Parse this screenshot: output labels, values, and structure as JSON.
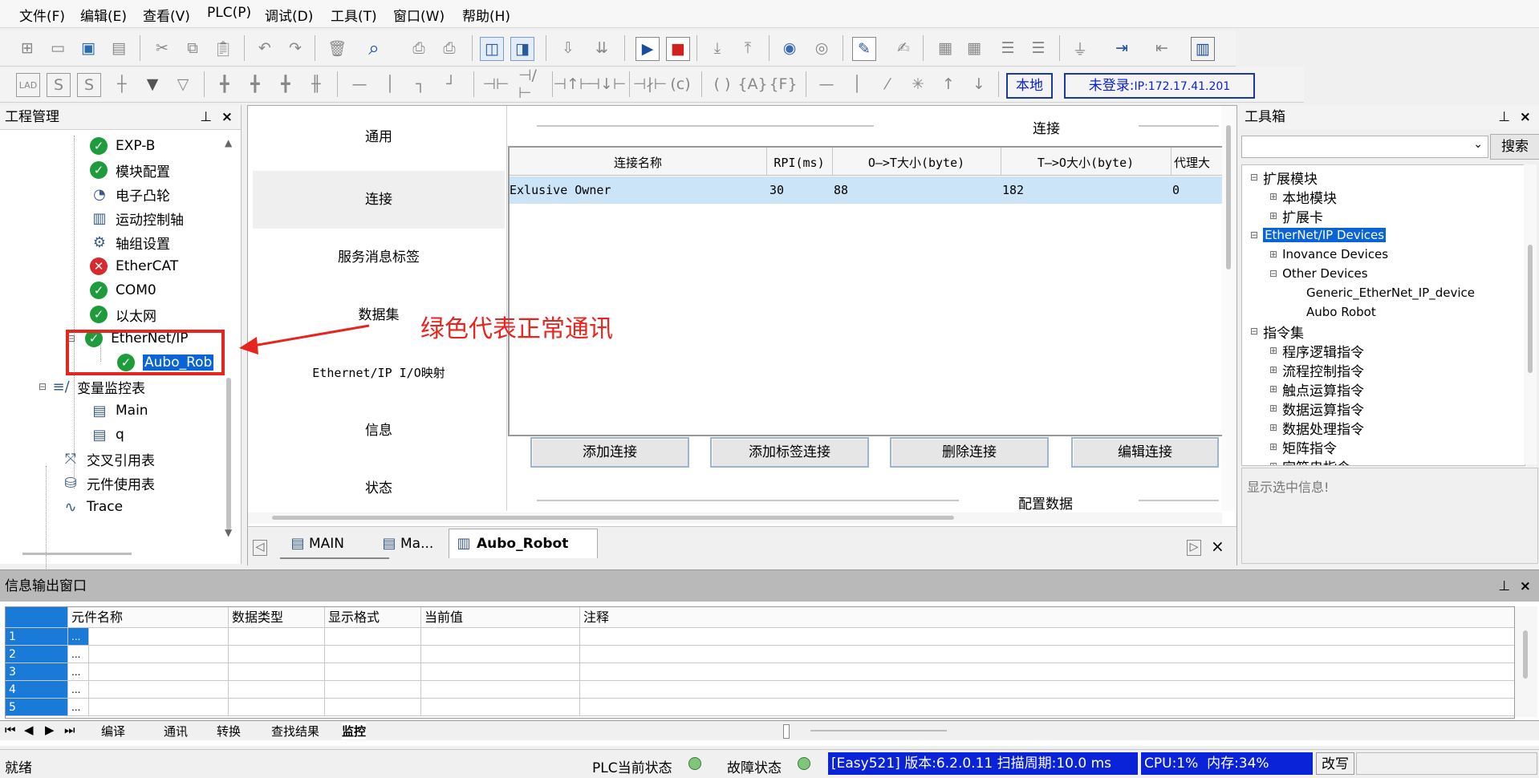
{
  "menu": [
    "文件(F)",
    "编辑(E)",
    "查看(V)",
    "PLC(P)",
    "调试(D)",
    "工具(T)",
    "窗口(W)",
    "帮助(H)"
  ],
  "toolbar2": {
    "local": "本地",
    "login": "未登录:",
    "ip": "IP:172.17.41.201"
  },
  "project_panel": {
    "title": "工程管理",
    "items": [
      {
        "label": "EXP-B",
        "status": "ok"
      },
      {
        "label": "模块配置",
        "status": "ok"
      },
      {
        "label": "电子凸轮",
        "status": "cam-icon"
      },
      {
        "label": "运动控制轴",
        "status": "axis-icon"
      },
      {
        "label": "轴组设置",
        "status": "gear-icon"
      },
      {
        "label": "EtherCAT",
        "status": "error"
      },
      {
        "label": "COM0",
        "status": "ok"
      },
      {
        "label": "以太网",
        "status": "ok"
      },
      {
        "label": "EtherNet/IP",
        "status": "ok"
      },
      {
        "label": "Aubo_Rob",
        "status": "ok"
      },
      {
        "label": "变量监控表",
        "status": "monitor-icon"
      },
      {
        "label": "Main",
        "status": "doc-icon"
      },
      {
        "label": "q",
        "status": "doc-icon"
      },
      {
        "label": "交叉引用表",
        "status": "cross-icon"
      },
      {
        "label": "元件使用表",
        "status": "db-icon"
      },
      {
        "label": "Trace",
        "status": "trace-icon"
      }
    ]
  },
  "annotation": {
    "text": "绿色代表正常通讯"
  },
  "config": {
    "nav": [
      "通用",
      "连接",
      "服务消息标签",
      "数据集",
      "Ethernet/IP I/O映射",
      "信息",
      "状态"
    ],
    "section_title": "连接",
    "columns": [
      "连接名称",
      "RPI(ms)",
      "O—>T大小(byte)",
      "T—>O大小(byte)",
      "代理大"
    ],
    "rows": [
      [
        "Exlusive Owner",
        "30",
        "88",
        "182",
        "0"
      ]
    ],
    "buttons": [
      "添加连接",
      "添加标签连接",
      "删除连接",
      "编辑连接"
    ],
    "bottom_section": "配置数据"
  },
  "editor_tabs": [
    "MAIN",
    "Ma...",
    "Aubo_Robot"
  ],
  "toolbox": {
    "title": "工具箱",
    "search_button": "搜索",
    "tree": [
      {
        "label": "扩展模块",
        "indent": 0,
        "sign": "⊟"
      },
      {
        "label": "本地模块",
        "indent": 1,
        "sign": "⊞"
      },
      {
        "label": "扩展卡",
        "indent": 1,
        "sign": "⊞"
      },
      {
        "label": "EtherNet/IP Devices",
        "indent": 0,
        "sign": "⊟",
        "selected": true
      },
      {
        "label": "Inovance Devices",
        "indent": 1,
        "sign": "⊞"
      },
      {
        "label": "Other Devices",
        "indent": 1,
        "sign": "⊟"
      },
      {
        "label": "Generic_EtherNet_IP_device",
        "indent": 2,
        "sign": ""
      },
      {
        "label": "Aubo Robot",
        "indent": 2,
        "sign": ""
      },
      {
        "label": "指令集",
        "indent": 0,
        "sign": "⊟"
      },
      {
        "label": "程序逻辑指令",
        "indent": 1,
        "sign": "⊞"
      },
      {
        "label": "流程控制指令",
        "indent": 1,
        "sign": "⊞"
      },
      {
        "label": "触点运算指令",
        "indent": 1,
        "sign": "⊞"
      },
      {
        "label": "数据运算指令",
        "indent": 1,
        "sign": "⊞"
      },
      {
        "label": "数据处理指令",
        "indent": 1,
        "sign": "⊞"
      },
      {
        "label": "矩阵指令",
        "indent": 1,
        "sign": "⊞"
      },
      {
        "label": "字符串指令",
        "indent": 1,
        "sign": "⊞"
      }
    ],
    "info": "显示选中信息!"
  },
  "output": {
    "title": "信息输出窗口",
    "columns": [
      "元件名称",
      "数据类型",
      "显示格式",
      "当前值",
      "注释"
    ],
    "rows": [
      "1",
      "2",
      "3",
      "4",
      "5"
    ],
    "cell_placeholder": "...",
    "tabs": [
      "编译",
      "通讯",
      "转换",
      "查找结果",
      "监控"
    ]
  },
  "status": {
    "ready": "就绪",
    "plc_state": "PLC当前状态",
    "fault_state": "故障状态",
    "version": "[Easy521] 版本:6.2.0.11 扫描周期:10.0 ms",
    "cpu": "CPU:1%  内存:34%",
    "mode": "改写"
  },
  "colors": {
    "ok": "#1e9c3b",
    "error": "#d9282e",
    "selected": "#0a64d6",
    "annotation": "#e8241f",
    "status_blue": "#0a22d8"
  }
}
